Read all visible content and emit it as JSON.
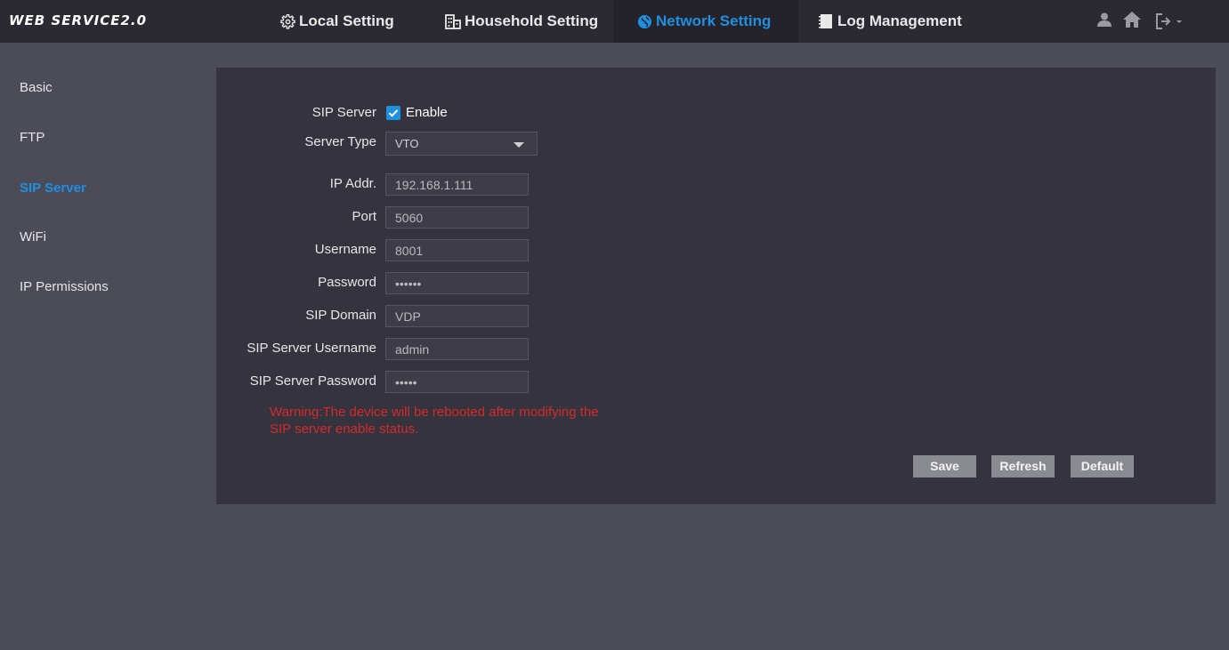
{
  "app": {
    "logo": "WEB SERVICE2.0"
  },
  "nav": {
    "tabs": [
      {
        "label": "Local Setting",
        "icon": "gear-icon"
      },
      {
        "label": "Household Setting",
        "icon": "building-icon"
      },
      {
        "label": "Network Setting",
        "icon": "globe-icon",
        "active": true
      },
      {
        "label": "Log Management",
        "icon": "document-icon"
      }
    ],
    "right_icons": [
      "user-icon",
      "home-icon",
      "logout-icon"
    ]
  },
  "sidebar": {
    "items": [
      {
        "label": "Basic"
      },
      {
        "label": "FTP"
      },
      {
        "label": "SIP Server",
        "active": true
      },
      {
        "label": "WiFi"
      },
      {
        "label": "IP Permissions"
      }
    ]
  },
  "form": {
    "sip_server_label": "SIP Server",
    "enable_label": "Enable",
    "enable_checked": true,
    "server_type_label": "Server Type",
    "server_type_value": "VTO",
    "fields": [
      {
        "label": "IP Addr.",
        "value": "192.168.1.111"
      },
      {
        "label": "Port",
        "value": "5060"
      },
      {
        "label": "Username",
        "value": "8001"
      },
      {
        "label": "Password",
        "value": "••••••"
      },
      {
        "label": "SIP Domain",
        "value": "VDP"
      },
      {
        "label": "SIP Server Username",
        "value": "admin"
      },
      {
        "label": "SIP Server Password",
        "value": "•••••"
      }
    ],
    "warning": "Warning:The device will be rebooted after modifying the SIP server enable status."
  },
  "buttons": {
    "save": "Save",
    "refresh": "Refresh",
    "default": "Default"
  },
  "colors": {
    "accent": "#1f8fe0",
    "warning": "#d42a2a",
    "background": "#4c4b58",
    "panel": "#35343e",
    "topbar": "#2b2a33"
  }
}
